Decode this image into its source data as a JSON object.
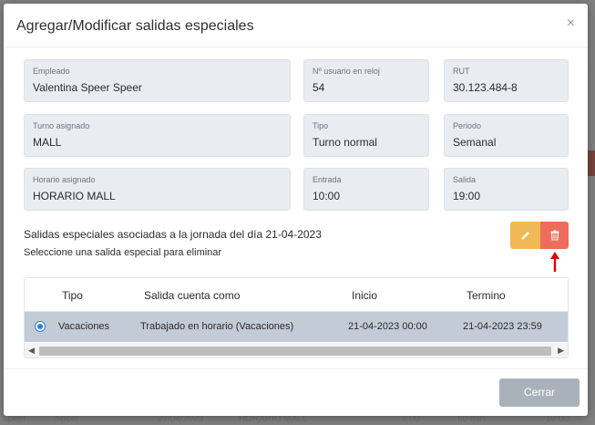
{
  "background": {
    "fragments": {
      "right_top_a": "ea",
      "right_top_b": "fi",
      "left_a": "0",
      "left_b": "Gi"
    },
    "bottom_row": [
      "Speer",
      "Speer",
      "27/04/2023",
      "HORARIO MALL",
      "8:00",
      "60 min.",
      "10:00"
    ]
  },
  "modal": {
    "title": "Agregar/Modificar salidas especiales",
    "close_glyph": "×"
  },
  "fields": {
    "empleado": {
      "label": "Empleado",
      "value": "Valentina Speer Speer"
    },
    "usuario_reloj": {
      "label": "Nº usuario en reloj",
      "value": "54"
    },
    "rut": {
      "label": "RUT",
      "value": "30.123.484-8"
    },
    "turno": {
      "label": "Turno asignado",
      "value": "MALL"
    },
    "tipo": {
      "label": "Tipo",
      "value": "Turno normal"
    },
    "periodo": {
      "label": "Periodo",
      "value": "Semanal"
    },
    "horario": {
      "label": "Horario asignado",
      "value": "HORARIO MALL"
    },
    "entrada": {
      "label": "Entrada",
      "value": "10:00"
    },
    "salida": {
      "label": "Salida",
      "value": "19:00"
    }
  },
  "info": {
    "line1": "Salidas especiales asociadas a la jornada del día 21-04-2023",
    "line2": "Seleccione una salida especial para eliminar"
  },
  "actions": {
    "edit_icon": "pencil-icon",
    "delete_icon": "trash-icon"
  },
  "table": {
    "headers": [
      "Tipo",
      "Salida cuenta como",
      "Inicio",
      "Termino"
    ],
    "rows": [
      {
        "selected": true,
        "tipo": "Vacaciones",
        "cuenta_como": "Trabajado en horario (Vacaciones)",
        "inicio": "21-04-2023 00:00",
        "termino": "21-04-2023 23:59"
      }
    ]
  },
  "footer": {
    "close_label": "Cerrar"
  },
  "colors": {
    "edit": "#f0b955",
    "delete": "#ec6d5b",
    "selected_row": "#c3cbd7",
    "arrow": "#e00000"
  }
}
